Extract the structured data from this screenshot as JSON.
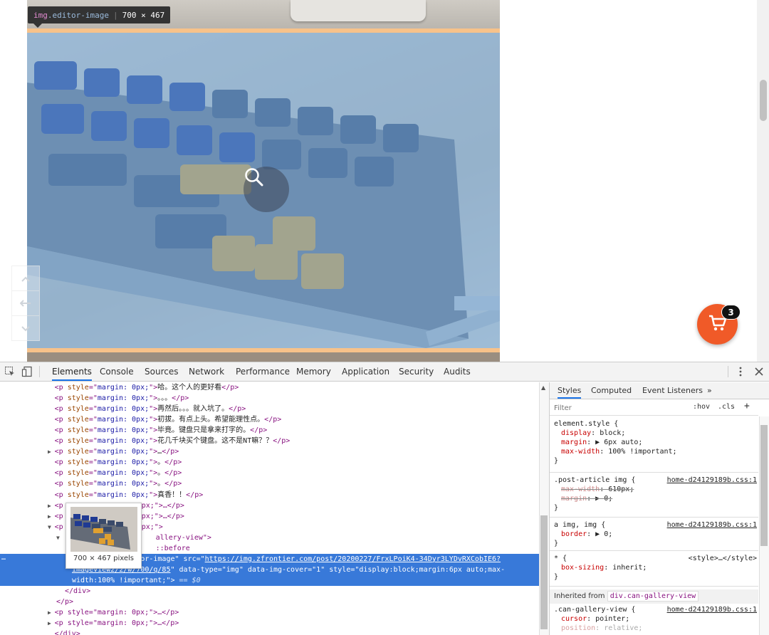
{
  "tooltip": {
    "tag": "img",
    "class": ".editor-image",
    "size": "700 × 467"
  },
  "cart": {
    "count": "3"
  },
  "devtools_tabs": [
    "Elements",
    "Console",
    "Sources",
    "Network",
    "Performance",
    "Memory",
    "Application",
    "Security",
    "Audits"
  ],
  "elements": {
    "lines": [
      {
        "t": "p",
        "s": "margin: 0px;",
        "text": "哈。这个人的更好看",
        "close": "</p>",
        "arrow": ""
      },
      {
        "t": "p",
        "s": "margin: 0px;",
        "text": "。。。",
        "close": "</p>",
        "arrow": ""
      },
      {
        "t": "p",
        "s": "margin: 0px;",
        "text": "再然后。。。就入坑了。",
        "close": "</p>",
        "arrow": ""
      },
      {
        "t": "p",
        "s": "margin: 0px;",
        "text": "初拔。有点上头。希望能理性点。",
        "close": "</p>",
        "arrow": ""
      },
      {
        "t": "p",
        "s": "margin: 0px;",
        "text": "毕竟。键盘只是拿来打字的。",
        "close": "</p>",
        "arrow": ""
      },
      {
        "t": "p",
        "s": "margin: 0px;",
        "text": "花几千块买个键盘。这不是NT嘛？？",
        "close": "</p>",
        "arrow": ""
      },
      {
        "t": "p",
        "s": "margin: 0px;",
        "text": "…",
        "close": "</p>",
        "arrow": "▶"
      },
      {
        "t": "p",
        "s": "margin: 0px;",
        "text": "。",
        "close": "</p>",
        "arrow": ""
      },
      {
        "t": "p",
        "s": "margin: 0px;",
        "text": "。",
        "close": "</p>",
        "arrow": ""
      },
      {
        "t": "p",
        "s": "margin: 0px;",
        "text": "。",
        "close": "</p>",
        "arrow": ""
      },
      {
        "t": "p",
        "s": "margin: 0px;",
        "text": "真香！！",
        "close": "</p>",
        "arrow": ""
      }
    ],
    "partial_lines": [
      {
        "indent": "▶",
        "open": "<p",
        "frag": "px;\">…</p>"
      },
      {
        "indent": "▶",
        "open": "<p",
        "frag": "px;\">…</p>"
      },
      {
        "indent": "▼",
        "open": "<p",
        "frag": "px;\">"
      },
      {
        "indent": "▼",
        "open": "",
        "frag": "allery-view\">"
      },
      {
        "indent": "",
        "open": "",
        "frag": "::before"
      }
    ],
    "selected": {
      "line1_pre": "<img class=\"editor-image\" src=\"",
      "url_part1": "https://img.zfrontier.com/post/20200227/FrxLPoiK4-34Dyr3LYDvRXCobIE6?",
      "url_part2": "imageView2/2/w/700/q/85",
      "line2_post": "\" data-type=\"img\" data-img-cover=\"1\" style=\"display:block;margin:6px auto;max-",
      "line3": "width:100% !important;\"> == $0"
    },
    "closing": [
      "</div>",
      "</p>"
    ],
    "after_lines": [
      {
        "arrow": "▶",
        "text": "<p style=\"margin: 0px;\">…</p>"
      },
      {
        "arrow": "▶",
        "text": "<p style=\"margin: 0px;\">…</p>"
      },
      {
        "arrow": "",
        "text": "</div>"
      }
    ],
    "hover_caption": "700 × 467 pixels",
    "dots": "…"
  },
  "styles": {
    "tabs": [
      "Styles",
      "Computed",
      "Event Listeners",
      "»"
    ],
    "filter_placeholder": "Filter",
    "hov": ":hov",
    "cls": ".cls",
    "plus": "+",
    "rules": [
      {
        "selector": "element.style {",
        "src": "",
        "props": [
          [
            "display",
            "block;"
          ],
          [
            "margin",
            "▶ 6px auto;"
          ],
          [
            "max-width",
            "100% !important;"
          ]
        ],
        "strike": []
      },
      {
        "selector": ".post-article img {",
        "src": "home-d24129189b.css:1",
        "props": [
          [
            "max-width",
            "610px;"
          ],
          [
            "margin",
            "▶ 0;"
          ]
        ],
        "strike": [
          0,
          1
        ]
      },
      {
        "selector": "a img, img {",
        "src": "home-d24129189b.css:1",
        "props": [
          [
            "border",
            "▶ 0;"
          ]
        ],
        "strike": []
      },
      {
        "selector": "* {",
        "src": "<style>…</style>",
        "props": [
          [
            "box-sizing",
            "inherit;"
          ]
        ],
        "strike": []
      }
    ],
    "inherited_label": "Inherited from",
    "inherited_chip": "div.can-gallery-view",
    "last_rule": {
      "selector": ".can-gallery-view {",
      "src": "home-d24129189b.css:1",
      "props": [
        [
          "cursor",
          "pointer;"
        ],
        [
          "position",
          "relative;"
        ]
      ]
    }
  },
  "colors": {
    "highlight": "#6fa8dc",
    "margin": "#f7c28a",
    "cart": "#f05a28",
    "selection": "#3879d9"
  },
  "icons": [
    "inspect-icon",
    "device-toggle-icon",
    "more-vertical-icon",
    "close-icon",
    "search-zoom-icon",
    "cart-icon",
    "chevron-up-icon",
    "arrows-icon",
    "chevron-down-icon"
  ]
}
